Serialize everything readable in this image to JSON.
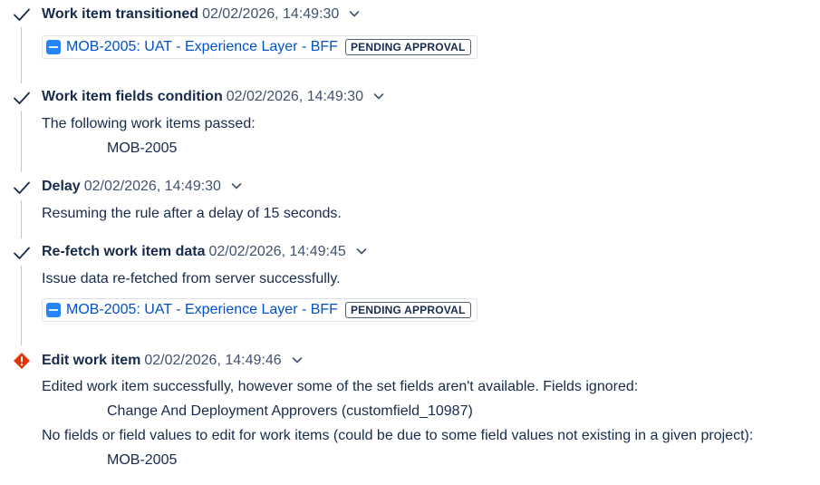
{
  "steps": [
    {
      "title": "Work item transitioned",
      "timestamp": "02/02/2026, 14:49:30",
      "status": "success",
      "issue": {
        "link_text": "MOB-2005: UAT - Experience Layer - BFF",
        "status_lozenge": "PENDING APPROVAL"
      }
    },
    {
      "title": "Work item fields condition",
      "timestamp": "02/02/2026, 14:49:30",
      "status": "success",
      "message": "The following work items passed:",
      "indented": "MOB-2005"
    },
    {
      "title": "Delay",
      "timestamp": "02/02/2026, 14:49:30",
      "status": "success",
      "message": "Resuming the rule after a delay of 15 seconds."
    },
    {
      "title": "Re-fetch work item data",
      "timestamp": "02/02/2026, 14:49:45",
      "status": "success",
      "message": "Issue data re-fetched from server successfully.",
      "issue": {
        "link_text": "MOB-2005: UAT - Experience Layer - BFF",
        "status_lozenge": "PENDING APPROVAL"
      }
    },
    {
      "title": "Edit work item",
      "timestamp": "02/02/2026, 14:49:46",
      "status": "error",
      "message": "Edited work item successfully, however some of the set fields aren't available. Fields ignored:",
      "indented": "Change And Deployment Approvers (customfield_10987)",
      "message2": "No fields or field values to edit for work items (could be due to some field values not existing in a given project):",
      "indented2": "MOB-2005"
    }
  ],
  "icons": {
    "success": "check-icon",
    "error": "error-diamond-icon",
    "expand": "chevron-down-icon",
    "issue_type": "issue-type-icon"
  },
  "colors": {
    "text": "#172b4d",
    "timestamp": "#42526e",
    "link": "#0052cc",
    "issue_type": "#2684ff",
    "error": "#de350b",
    "connector": "#c1c7d0"
  }
}
